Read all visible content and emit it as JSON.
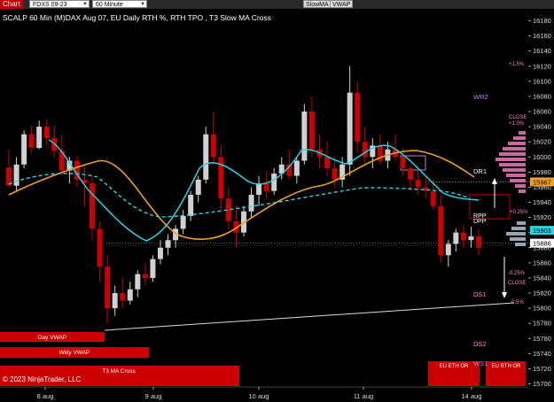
{
  "toolbar": {
    "chart_label": "Chart",
    "instrument": "FDXS 09-23",
    "interval": "60 Minute",
    "btn_slow_ma": "SlowMA",
    "btn_vwap": "VWAP"
  },
  "chart_title": "SCALP 60 Min (M)DAX Aug 07, EU Daily RTH %, RTH TPO , T3 Slow MA Cross",
  "copyright": "© 2023 NinjaTrader, LLC",
  "colors": {
    "background": "#000000",
    "bull_candle": "#d0d0d0",
    "bear_candle": "#cc0000",
    "cyan_ma": "#22d8e8",
    "orange_ma": "#f0a020",
    "label_red": "#cc0000",
    "pivot_purple": "#c080e0",
    "percent_pink": "#ff80c0"
  },
  "chart_data": {
    "type": "candlestick",
    "ylim": [
      15700,
      16190
    ],
    "y_ticks": [
      16180,
      16160,
      16140,
      16120,
      16100,
      16080,
      16060,
      16040,
      16020,
      16000,
      15980,
      15960,
      15940,
      15920,
      15900,
      15880,
      15860,
      15840,
      15820,
      15800,
      15780,
      15760,
      15740,
      15720,
      15700
    ],
    "x_labels": [
      "8 aug",
      "9 aug",
      "10 aug",
      "11 aug",
      "14 aug"
    ],
    "price_tags": [
      {
        "value": "15967",
        "price": 15967,
        "color": "#f0a020",
        "text_color": "#000"
      },
      {
        "value": "15903",
        "price": 15903,
        "color": "#22d8e8",
        "text_color": "#000"
      },
      {
        "value": "15886",
        "price": 15886,
        "color": "#ffffff",
        "text_color": "#000"
      }
    ],
    "candles": [
      [
        15986,
        16010,
        15960,
        15962
      ],
      [
        15962,
        16000,
        15955,
        15990
      ],
      [
        15990,
        16035,
        15985,
        16030
      ],
      [
        16030,
        16042,
        16005,
        16012
      ],
      [
        16012,
        16048,
        16010,
        16040
      ],
      [
        16040,
        16050,
        16015,
        16025
      ],
      [
        16025,
        16042,
        16000,
        16008
      ],
      [
        16008,
        16030,
        15975,
        15982
      ],
      [
        15982,
        16000,
        15965,
        15995
      ],
      [
        15995,
        16000,
        15960,
        15970
      ],
      [
        15970,
        15990,
        15935,
        15965
      ],
      [
        15965,
        15975,
        15890,
        15905
      ],
      [
        15905,
        15915,
        15835,
        15855
      ],
      [
        15855,
        15870,
        15780,
        15800
      ],
      [
        15800,
        15830,
        15790,
        15820
      ],
      [
        15820,
        15840,
        15800,
        15810
      ],
      [
        15810,
        15835,
        15805,
        15825
      ],
      [
        15825,
        15850,
        15815,
        15845
      ],
      [
        15845,
        15860,
        15830,
        15840
      ],
      [
        15840,
        15870,
        15835,
        15865
      ],
      [
        15865,
        15890,
        15858,
        15880
      ],
      [
        15880,
        15898,
        15870,
        15890
      ],
      [
        15890,
        15910,
        15880,
        15905
      ],
      [
        15905,
        15930,
        15898,
        15922
      ],
      [
        15922,
        15955,
        15915,
        15950
      ],
      [
        15950,
        15975,
        15940,
        15970
      ],
      [
        15970,
        16040,
        15965,
        16030
      ],
      [
        16030,
        16060,
        15990,
        16000
      ],
      [
        16000,
        16015,
        15930,
        15945
      ],
      [
        15945,
        15960,
        15905,
        15915
      ],
      [
        15915,
        15935,
        15880,
        15900
      ],
      [
        15900,
        15935,
        15895,
        15928
      ],
      [
        15928,
        15960,
        15920,
        15950
      ],
      [
        15950,
        15975,
        15935,
        15965
      ],
      [
        15965,
        15980,
        15945,
        15955
      ],
      [
        15955,
        15985,
        15950,
        15978
      ],
      [
        15978,
        16000,
        15970,
        15990
      ],
      [
        15990,
        16010,
        15970,
        15975
      ],
      [
        15975,
        16000,
        15965,
        15995
      ],
      [
        15995,
        16070,
        15990,
        16060
      ],
      [
        16060,
        16080,
        16000,
        16010
      ],
      [
        16010,
        16030,
        15985,
        16000
      ],
      [
        16000,
        16020,
        15975,
        15985
      ],
      [
        15985,
        16000,
        15960,
        15970
      ],
      [
        15970,
        16000,
        15960,
        15990
      ],
      [
        15990,
        16120,
        15975,
        16085
      ],
      [
        16085,
        16100,
        16005,
        16020
      ],
      [
        16020,
        16040,
        15990,
        16000
      ],
      [
        16000,
        16025,
        15985,
        16015
      ],
      [
        16015,
        16030,
        15990,
        15995
      ],
      [
        15995,
        16020,
        15985,
        16010
      ],
      [
        16010,
        16030,
        15995,
        16000
      ],
      [
        16000,
        16012,
        15975,
        15985
      ],
      [
        15985,
        15990,
        15955,
        15970
      ],
      [
        15970,
        15985,
        15950,
        15960
      ],
      [
        15960,
        15975,
        15945,
        15955
      ],
      [
        15955,
        15970,
        15930,
        15935
      ],
      [
        15935,
        15950,
        15860,
        15870
      ],
      [
        15870,
        15890,
        15855,
        15885
      ],
      [
        15885,
        15905,
        15875,
        15900
      ],
      [
        15900,
        15910,
        15880,
        15890
      ],
      [
        15890,
        15908,
        15880,
        15895
      ],
      [
        15895,
        15905,
        15870,
        15880
      ]
    ]
  },
  "left_bars": [
    {
      "label": "Day VWAP"
    },
    {
      "label": "Wkly VWAP"
    },
    {
      "label": "T3 MA Cross"
    }
  ],
  "bottom_boxes": [
    {
      "label": "EU ETH OR"
    },
    {
      "label": "EU RTH OR"
    }
  ],
  "right_labels": {
    "pct_plus_1_5": "+1.5%",
    "pct_plus_1_0": "+1.0%",
    "close_top": "CLOSE",
    "wr2": "WR2",
    "dr1": "DR1",
    "pct_plus_0_25": "+0.25%",
    "rpp": "RPP",
    "dpp": "DPP",
    "pct_minus_0_25": "-0.25%",
    "close_bottom": "CLOSE",
    "ds1": "DS1",
    "pct_minus_0_5": "0.5%",
    "ds2": "DS2",
    "ws1": "WS1"
  }
}
